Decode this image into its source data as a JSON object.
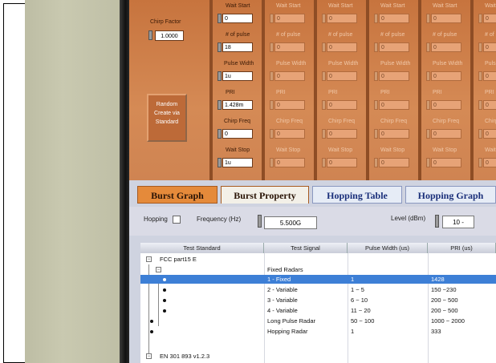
{
  "panel": {
    "chirp_factor_label": "Chirp Factor",
    "chirp_factor_value": "1.0000",
    "random_button": "Random Create via Standard",
    "labels": {
      "wait_start": "Wait Start",
      "num_pulse": "# of pulse",
      "pulse_width": "Pulse Width",
      "pri": "PRI",
      "chirp_freq": "Chirp Freq",
      "wait_stop": "Wait Stop"
    },
    "col1": {
      "wait_start": "0",
      "num_pulse": "18",
      "pulse_width": "1u",
      "pri": "1.428m",
      "chirp_freq": "0",
      "wait_stop": "1u"
    },
    "other_cols_value": "0"
  },
  "tabs": [
    {
      "label": "Burst Graph"
    },
    {
      "label": "Burst Property"
    },
    {
      "label": "Hopping Table"
    },
    {
      "label": "Hopping Graph"
    }
  ],
  "controls": {
    "hopping_label": "Hopping",
    "frequency_label": "Frequency (Hz)",
    "frequency_value": "5.500G",
    "level_label": "Level (dBm)",
    "level_value": "10 -"
  },
  "table": {
    "headers": [
      "Test Standard",
      "Test Signal",
      "Pulse Width (us)",
      "PRI (us)"
    ],
    "group1": "FCC part15 E",
    "subgroup": "Fixed Radars",
    "rows": [
      {
        "signal": "1 - Fixed",
        "pw": "1",
        "pri": "1428"
      },
      {
        "signal": "2 - Variable",
        "pw": "1 ~ 5",
        "pri": "150 ~230"
      },
      {
        "signal": "3 - Variable",
        "pw": "6 ~ 10",
        "pri": "200 ~ 500"
      },
      {
        "signal": "4 - Variable",
        "pw": "11 ~ 20",
        "pri": "200 ~ 500"
      },
      {
        "signal": "Long Pulse Radar",
        "pw": "50 ~ 100",
        "pri": "1000 ~ 2000"
      },
      {
        "signal": "Hopping Radar",
        "pw": "1",
        "pri": "333"
      }
    ],
    "group2": "EN 301 893 v1.2.3"
  }
}
